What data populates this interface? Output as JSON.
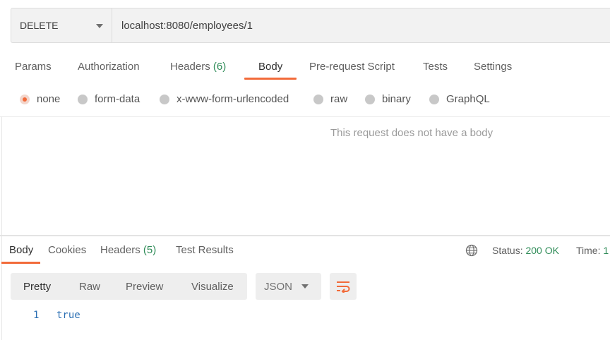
{
  "request": {
    "method": "DELETE",
    "url": "localhost:8080/employees/1"
  },
  "request_tabs": [
    {
      "label": "Params",
      "count": ""
    },
    {
      "label": "Authorization",
      "count": ""
    },
    {
      "label": "Headers",
      "count": "(6)"
    },
    {
      "label": "Body",
      "count": ""
    },
    {
      "label": "Pre-request Script",
      "count": ""
    },
    {
      "label": "Tests",
      "count": ""
    },
    {
      "label": "Settings",
      "count": ""
    }
  ],
  "active_request_tab": "Body",
  "body_types": [
    {
      "label": "none",
      "selected": true
    },
    {
      "label": "form-data",
      "selected": false
    },
    {
      "label": "x-www-form-urlencoded",
      "selected": false
    },
    {
      "label": "raw",
      "selected": false
    },
    {
      "label": "binary",
      "selected": false
    },
    {
      "label": "GraphQL",
      "selected": false
    }
  ],
  "empty_body_message": "This request does not have a body",
  "response_tabs": [
    {
      "label": "Body",
      "count": ""
    },
    {
      "label": "Cookies",
      "count": ""
    },
    {
      "label": "Headers",
      "count": "(5)"
    },
    {
      "label": "Test Results",
      "count": ""
    }
  ],
  "active_response_tab": "Body",
  "response_meta": {
    "status_label": "Status:",
    "status_value": "200 OK",
    "time_label": "Time:",
    "time_value": "1"
  },
  "view_modes": [
    "Pretty",
    "Raw",
    "Preview",
    "Visualize"
  ],
  "active_view_mode": "Pretty",
  "format": "JSON",
  "response_body": [
    {
      "line": "1",
      "text": "true"
    }
  ],
  "icons": {
    "globe": "globe-icon",
    "wrap": "wrap-lines-icon",
    "dropdown": "chevron-down-icon"
  },
  "colors": {
    "accent": "#f26b3a",
    "success": "#2e8b57",
    "code": "#2b6fb3"
  }
}
